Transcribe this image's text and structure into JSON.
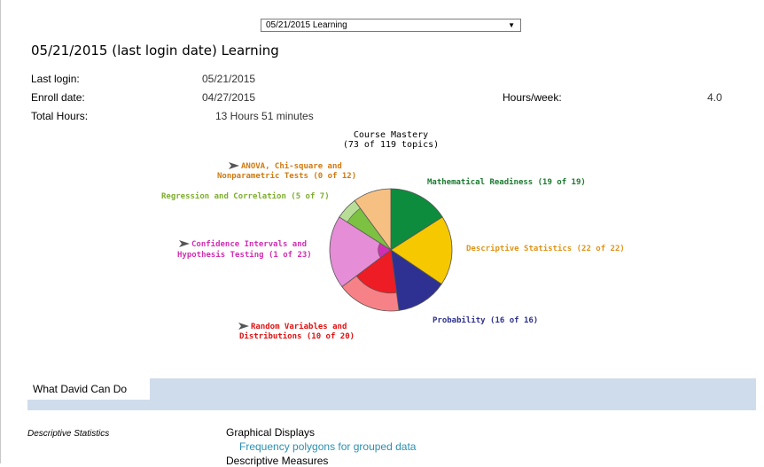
{
  "report_select": {
    "value": "05/21/2015 Learning",
    "arrow": "▼"
  },
  "page_title": "05/21/2015 (last login date) Learning",
  "stats": {
    "last_login_label": "Last login:",
    "last_login_value": "05/21/2015",
    "enroll_label": "Enroll date:",
    "enroll_value": "04/27/2015",
    "hours_week_label": "Hours/week:",
    "hours_week_value": "4.0",
    "total_hours_label": "Total Hours:",
    "total_hours_value": "13 Hours 51 minutes"
  },
  "chart_data": {
    "type": "pie",
    "title": "Course Mastery",
    "subtitle": "(73 of 119 topics)",
    "slices": [
      {
        "label": "Mathematical Readiness (19 of 19)",
        "mastered": 19,
        "total": 19,
        "color": "#0e8c3e"
      },
      {
        "label": "Descriptive Statistics (22 of 22)",
        "mastered": 22,
        "total": 22,
        "color": "#f5c800"
      },
      {
        "label": "Probability (16 of 16)",
        "mastered": 16,
        "total": 16,
        "color": "#2e3192"
      },
      {
        "label": "Random Variables and Distributions (10 of 20)",
        "mastered": 10,
        "total": 20,
        "color": "#ee1c24"
      },
      {
        "label": "Confidence Intervals and Hypothesis Testing (1 of 23)",
        "mastered": 1,
        "total": 23,
        "color": "#d02fb4"
      },
      {
        "label": "Regression and Correlation (5 of 7)",
        "mastered": 5,
        "total": 7,
        "color": "#7dc142"
      },
      {
        "label": "ANOVA, Chi-square and Nonparametric Tests (0 of 12)",
        "mastered": 0,
        "total": 12,
        "color": "#f08c1e"
      }
    ],
    "label_colors": [
      "#1a7a2e",
      "#e0941a",
      "#2e3192",
      "#e01010",
      "#d02fb4",
      "#7dae2e",
      "#d07a10"
    ]
  },
  "labels": {
    "math_readiness": "Mathematical Readiness (19 of 19)",
    "descriptive": "Descriptive Statistics (22 of 22)",
    "probability": "Probability (16 of 16)",
    "random_vars_1": "Random Variables and",
    "random_vars_2": "Distributions (10 of 20)",
    "conf_int_1": "Confidence Intervals and",
    "conf_int_2": "Hypothesis Testing (1 of 23)",
    "regression": "Regression and Correlation (5 of 7)",
    "anova_1": "ANOVA, Chi-square and",
    "anova_2": "Nonparametric Tests (0 of 12)"
  },
  "section": {
    "tab_label": "What David Can Do",
    "category": "Descriptive Statistics",
    "group_1": "Graphical Displays",
    "skill_1": "Frequency polygons for grouped data",
    "group_2": "Descriptive Measures"
  }
}
